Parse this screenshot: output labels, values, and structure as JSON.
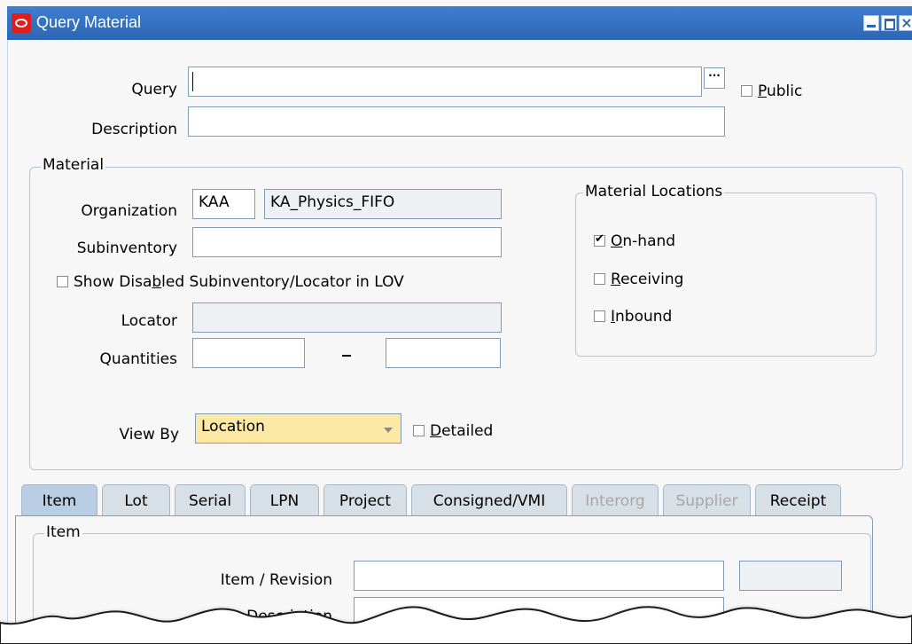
{
  "window": {
    "title": "Query Material"
  },
  "query": {
    "query_label": "Query",
    "query_value": "",
    "public_label_pre": "",
    "public_label_u": "P",
    "public_label_post": "ublic",
    "public_checked": false,
    "description_label": "Description",
    "description_value": ""
  },
  "material": {
    "legend": "Material",
    "organization_label": "Organization",
    "organization_code": "KAA",
    "organization_name": "KA_Physics_FIFO",
    "subinventory_label": "Subinventory",
    "subinventory_value": "",
    "show_disabled_pre": "Show Disa",
    "show_disabled_u": "b",
    "show_disabled_post": "led Subinventory/Locator in LOV",
    "show_disabled_checked": false,
    "locator_label": "Locator",
    "locator_value": "",
    "quantities_label": "Quantities",
    "qty_from": "",
    "qty_to": "",
    "qty_separator": "-",
    "view_by_label": "View By",
    "view_by_value": "Location",
    "detailed_u": "D",
    "detailed_post": "etailed",
    "detailed_checked": false
  },
  "locations": {
    "legend": "Material Locations",
    "items": [
      {
        "u": "O",
        "rest": "n-hand",
        "checked": true
      },
      {
        "u": "R",
        "rest": "eceiving",
        "checked": false
      },
      {
        "u": "I",
        "rest": "nbound",
        "checked": false
      }
    ]
  },
  "tabs": [
    {
      "label": "Item",
      "state": "active"
    },
    {
      "label": "Lot",
      "state": "normal"
    },
    {
      "label": "Serial",
      "state": "normal"
    },
    {
      "label": "LPN",
      "state": "normal"
    },
    {
      "label": "Project",
      "state": "normal"
    },
    {
      "label": "Consigned/VMI",
      "state": "normal"
    },
    {
      "label": "Interorg",
      "state": "disabled"
    },
    {
      "label": "Supplier",
      "state": "disabled"
    },
    {
      "label": "Receipt",
      "state": "normal"
    }
  ],
  "item_panel": {
    "legend": "Item",
    "item_revision_label": "Item / Revision",
    "item_value": "",
    "revision_value": "",
    "description_label": "Description",
    "description_value": ""
  }
}
